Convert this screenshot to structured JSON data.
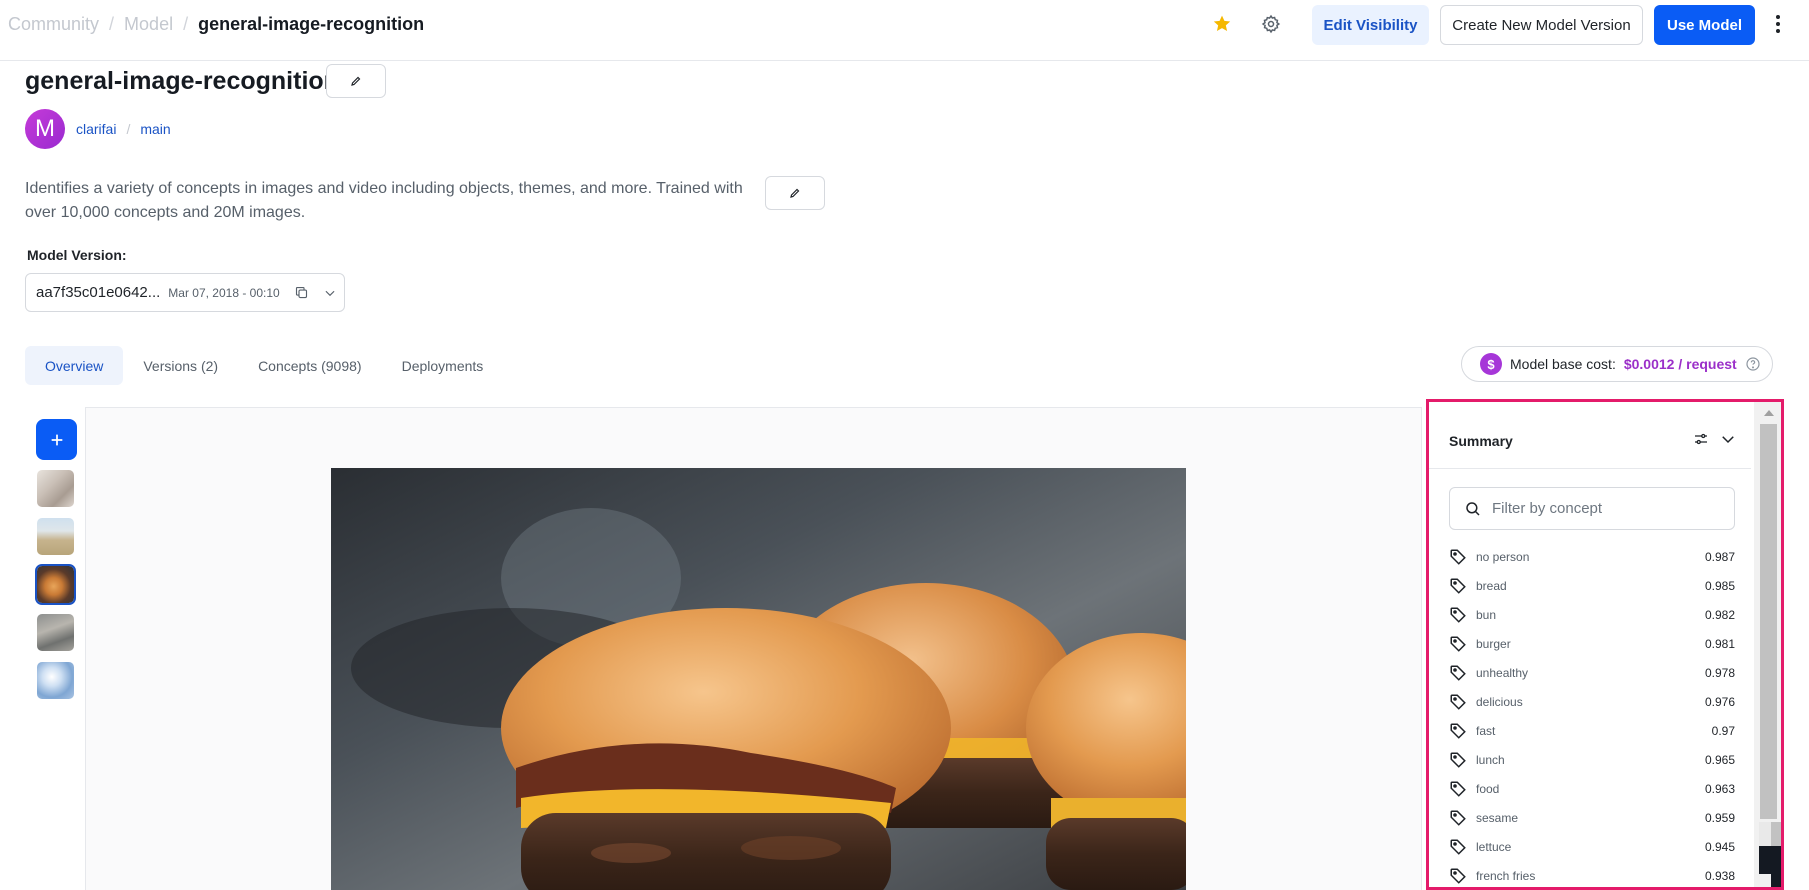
{
  "header": {
    "breadcrumb": [
      "Community",
      "Model",
      "general-image-recognition"
    ],
    "buttons": {
      "edit_visibility": "Edit Visibility",
      "create_version": "Create New Model Version",
      "use_model": "Use Model"
    }
  },
  "model": {
    "title": "general-image-recognition",
    "avatar_letter": "M",
    "owner": "clarifai",
    "app": "main",
    "description": "Identifies a variety of concepts in images and video including objects, themes, and more. Trained with over 10,000 concepts and 20M images."
  },
  "model_version": {
    "label": "Model Version:",
    "id": "aa7f35c01e0642...",
    "date": "Mar 07, 2018 - 00:10"
  },
  "tabs": [
    {
      "label": "Overview",
      "active": true
    },
    {
      "label": "Versions (2)",
      "active": false
    },
    {
      "label": "Concepts (9098)",
      "active": false
    },
    {
      "label": "Deployments",
      "active": false
    }
  ],
  "cost": {
    "icon_text": "$",
    "label": "Model base cost:",
    "value": "$0.0012 / request"
  },
  "summary": {
    "title": "Summary",
    "filter_placeholder": "Filter by concept",
    "concepts": [
      {
        "name": "no person",
        "score": "0.987"
      },
      {
        "name": "bread",
        "score": "0.985"
      },
      {
        "name": "bun",
        "score": "0.982"
      },
      {
        "name": "burger",
        "score": "0.981"
      },
      {
        "name": "unhealthy",
        "score": "0.978"
      },
      {
        "name": "delicious",
        "score": "0.976"
      },
      {
        "name": "fast",
        "score": "0.97"
      },
      {
        "name": "lunch",
        "score": "0.965"
      },
      {
        "name": "food",
        "score": "0.963"
      },
      {
        "name": "sesame",
        "score": "0.959"
      },
      {
        "name": "lettuce",
        "score": "0.945"
      },
      {
        "name": "french fries",
        "score": "0.938"
      }
    ]
  },
  "thumbnails": [
    {
      "subject": "interior",
      "active": false
    },
    {
      "subject": "field",
      "active": false
    },
    {
      "subject": "burgers",
      "active": true
    },
    {
      "subject": "street",
      "active": false
    },
    {
      "subject": "sky",
      "active": false
    }
  ],
  "colors": {
    "accent": "#0a5cf5",
    "highlight_border": "#e41b6a",
    "cost_purple": "#9b30c9",
    "star": "#f5b800"
  }
}
